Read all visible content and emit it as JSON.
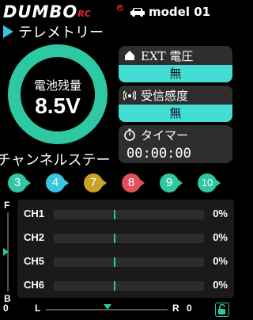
{
  "header": {
    "logo_main": "DUMBO",
    "logo_rc": "RC",
    "logo_reg": "R",
    "model_name": "model 01"
  },
  "telemetry": {
    "title": "テレメトリー",
    "battery_label": "電池残量",
    "battery_value": "8.5V",
    "ext_voltage_label": "EXT 電圧",
    "ext_voltage_value": "無",
    "signal_label": "受信感度",
    "signal_value": "無",
    "timer_label": "タイマー",
    "timer_value": "00:00:00"
  },
  "channel_status": {
    "title": "チャンネルステー",
    "badges": [
      {
        "label": "3",
        "color": "#2ec8a2"
      },
      {
        "label": "4",
        "color": "#39c6df"
      },
      {
        "label": "7",
        "color": "#c9a227"
      },
      {
        "label": "8",
        "color": "#e2505a"
      },
      {
        "label": "9",
        "color": "#2ec8a2"
      },
      {
        "label": "10",
        "color": "#2ec8a2"
      }
    ],
    "rows": [
      {
        "name": "CH1",
        "percent": "0%"
      },
      {
        "name": "CH2",
        "percent": "0%"
      },
      {
        "name": "CH5",
        "percent": "0%"
      },
      {
        "name": "CH6",
        "percent": "0%"
      }
    ]
  },
  "trims": {
    "vertical_top": "F",
    "vertical_bottom": "B",
    "vertical_value": "0",
    "horizontal_left": "L",
    "horizontal_right": "R",
    "horizontal_value": "0"
  },
  "colors": {
    "accent": "#2ec8a2",
    "cyan": "#44ddd4",
    "brand_red": "#e2262b"
  }
}
